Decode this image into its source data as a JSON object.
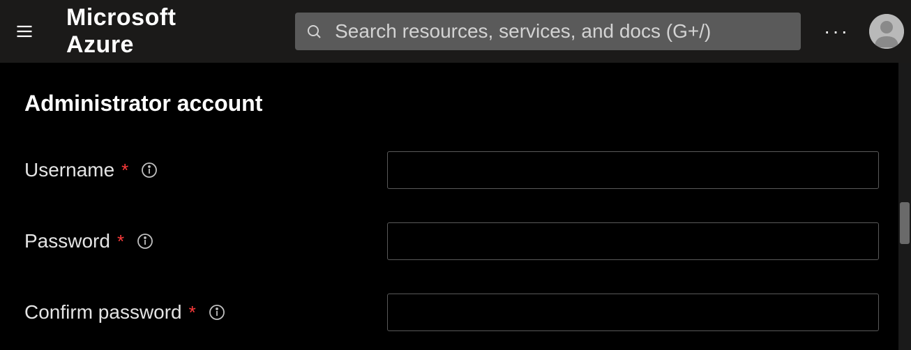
{
  "header": {
    "brand": "Microsoft Azure",
    "search_placeholder": "Search resources, services, and docs (G+/)",
    "more_label": "···"
  },
  "main": {
    "section_title": "Administrator account",
    "fields": [
      {
        "label": "Username",
        "value": ""
      },
      {
        "label": "Password",
        "value": ""
      },
      {
        "label": "Confirm password",
        "value": ""
      }
    ],
    "required_marker": "*"
  }
}
